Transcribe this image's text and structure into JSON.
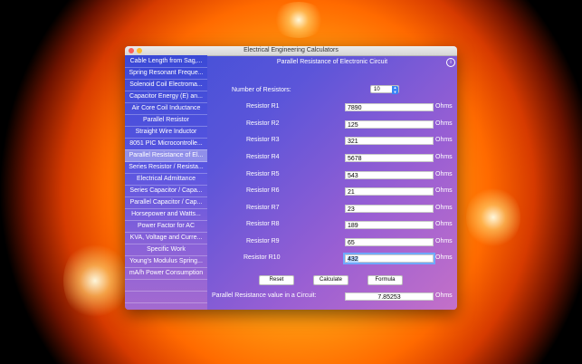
{
  "window": {
    "title": "Electrical Engineering Calculators"
  },
  "sidebar": {
    "items": [
      {
        "label": "Cable Length from Sag,..."
      },
      {
        "label": "Spring Resonant Freque..."
      },
      {
        "label": "Solenoid Coil Electroma..."
      },
      {
        "label": "Capacitor Energy (E) an..."
      },
      {
        "label": "Air Core Coil Inductance"
      },
      {
        "label": "Parallel Resistor"
      },
      {
        "label": "Straight Wire Inductor"
      },
      {
        "label": "8051 PIC Microcontrolle..."
      },
      {
        "label": "Parallel Resistance of El..."
      },
      {
        "label": "Series Resistor / Resista..."
      },
      {
        "label": "Electrical Admittance"
      },
      {
        "label": "Series Capacitor / Capa..."
      },
      {
        "label": "Parallel Capacitor / Cap..."
      },
      {
        "label": "Horsepower and Watts..."
      },
      {
        "label": "Power Factor for AC"
      },
      {
        "label": "KVA, Voltage and Curre..."
      },
      {
        "label": "Specific Work"
      },
      {
        "label": "Young's Modulus Spring..."
      },
      {
        "label": "mA/h Power Consumption"
      }
    ],
    "selected_index": 8
  },
  "main": {
    "heading": "Parallel Resistance of Electronic Circuit",
    "info_icon": "i",
    "count_label": "Number of Resistors:",
    "count_value": "10",
    "unit": "Ohms",
    "resistors": [
      {
        "label": "Resistor R1",
        "value": "7890"
      },
      {
        "label": "Resistor R2",
        "value": "125"
      },
      {
        "label": "Resistor R3",
        "value": "321"
      },
      {
        "label": "Resistor R4",
        "value": "5678"
      },
      {
        "label": "Resistor R5",
        "value": "543"
      },
      {
        "label": "Resistor R6",
        "value": "21"
      },
      {
        "label": "Resistor R7",
        "value": "23"
      },
      {
        "label": "Resistor R8",
        "value": "189"
      },
      {
        "label": "Resistor R9",
        "value": "65"
      },
      {
        "label": "Resistor R10",
        "value": "432"
      }
    ],
    "buttons": {
      "reset": "Reset",
      "calculate": "Calculate",
      "formula": "Formula"
    },
    "result_label": "Parallel Resistance value in a Circuit:",
    "result_value": "7.85253",
    "result_unit": "Ohms"
  },
  "colors": {
    "accent": "#3b83f7",
    "panel_top": "#3a49d6",
    "panel_bottom": "#c470c8"
  }
}
